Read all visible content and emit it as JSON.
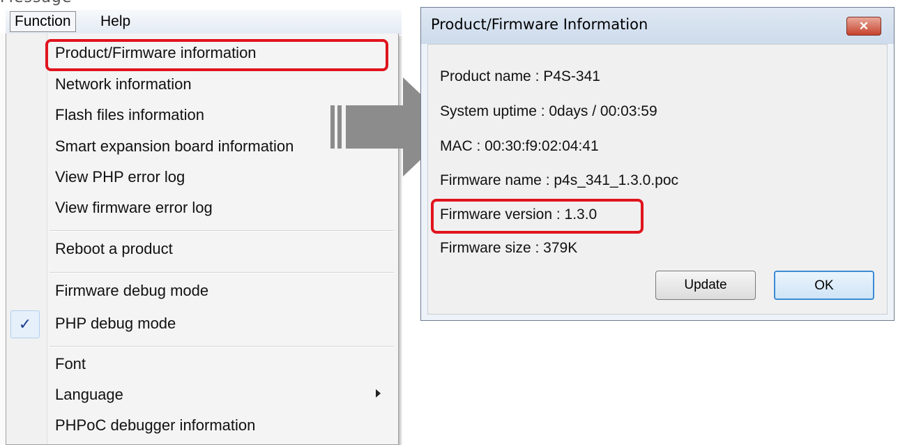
{
  "top_fragment": "Message",
  "menubar": {
    "items": [
      {
        "label": "Function"
      },
      {
        "label": "Help"
      }
    ]
  },
  "menu": {
    "items": [
      {
        "label": "Product/Firmware information",
        "highlighted": true
      },
      {
        "label": "Network information"
      },
      {
        "label": "Flash files information"
      },
      {
        "label": "Smart expansion board information"
      },
      {
        "label": "View PHP error log"
      },
      {
        "label": "View firmware error log"
      },
      {
        "label": "Reboot a product"
      },
      {
        "label": "Firmware debug mode"
      },
      {
        "label": "PHP debug mode",
        "checked": true
      },
      {
        "label": "Font"
      },
      {
        "label": "Language",
        "submenu": true
      },
      {
        "label": "PHPoC debugger information"
      }
    ],
    "check_glyph": "✓"
  },
  "dialog": {
    "title": "Product/Firmware Information",
    "close_label": "✕",
    "lines": {
      "product_name": "Product name : P4S-341",
      "uptime": "System uptime : 0days / 00:03:59",
      "mac": "MAC : 00:30:f9:02:04:41",
      "firmware_name": "Firmware name : p4s_341_1.3.0.poc",
      "firmware_version": "Firmware version : 1.3.0",
      "firmware_size": "Firmware size : 379K"
    },
    "buttons": {
      "update": "Update",
      "ok": "OK"
    }
  },
  "colors": {
    "highlight": "#e0141e",
    "arrow": "#8c8c8c"
  },
  "icons": [
    "check-icon",
    "submenu-arrow-icon",
    "close-icon",
    "right-arrow-icon"
  ]
}
